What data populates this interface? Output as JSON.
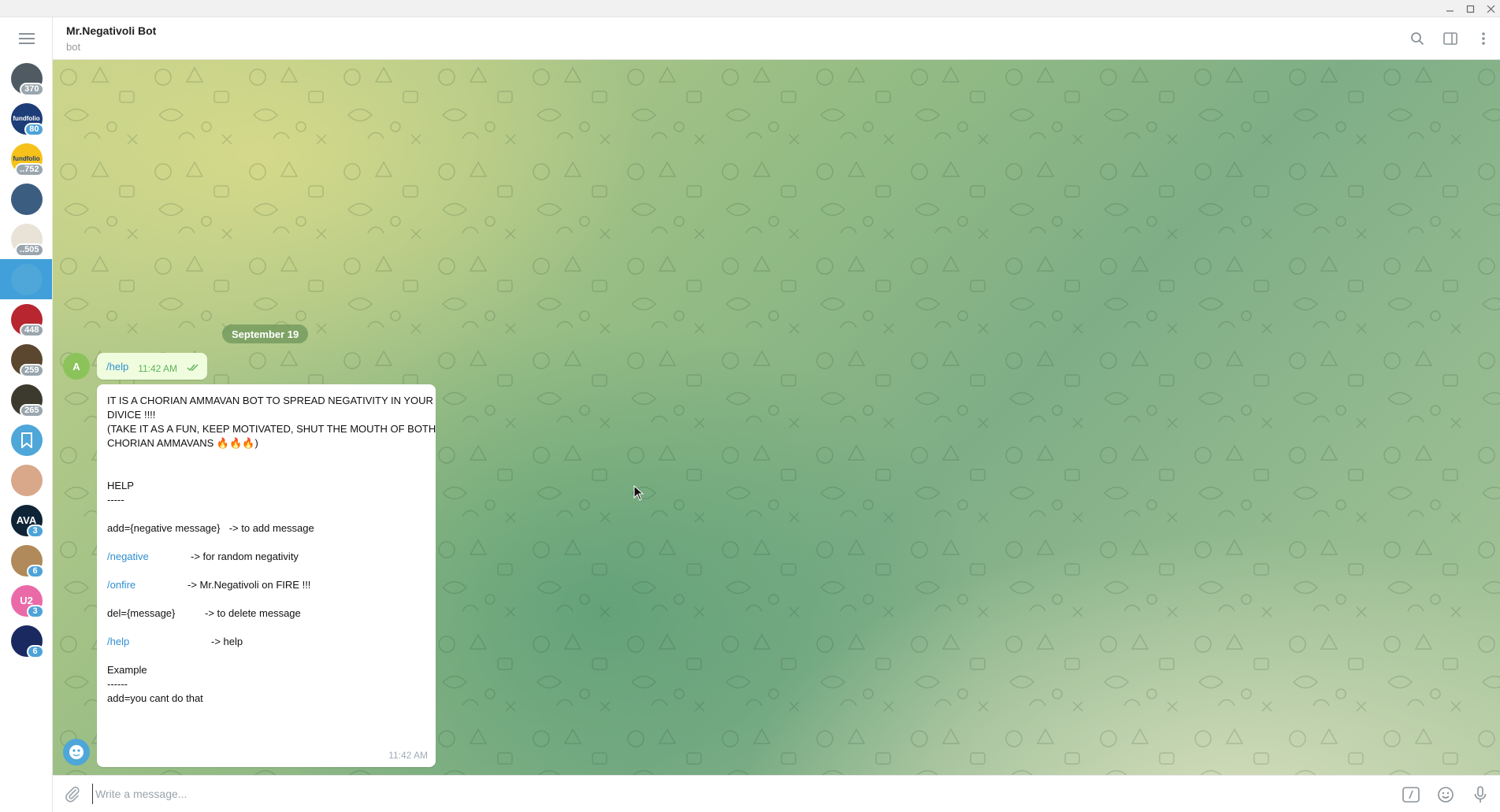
{
  "window": {
    "controls": [
      "minimize-icon",
      "maximize-icon",
      "close-icon"
    ]
  },
  "rail": {
    "items": [
      {
        "name": "chat-1",
        "badge": "370",
        "color": "#4f5a62",
        "label": ""
      },
      {
        "name": "chat-fundfolio-1",
        "badge": "80",
        "color": "#1d3d78",
        "label": "fundfolio"
      },
      {
        "name": "chat-fundfolio-2",
        "badge": "..752",
        "color": "#f6c21a",
        "label": "fundfolio"
      },
      {
        "name": "chat-person-1",
        "badge": "",
        "color": "#3b5d80",
        "label": ""
      },
      {
        "name": "chat-group-1",
        "badge": "..505",
        "color": "#e9e2d6",
        "label": ""
      },
      {
        "name": "chat-mr-negativoli-bot",
        "badge": "",
        "color": "#4ea6d9",
        "label": "",
        "active": true
      },
      {
        "name": "chat-group-2",
        "badge": "448",
        "color": "#b8262f",
        "label": ""
      },
      {
        "name": "chat-group-3",
        "badge": "259",
        "color": "#5b4630",
        "label": ""
      },
      {
        "name": "chat-group-4",
        "badge": "265",
        "color": "#3c3a2f",
        "label": ""
      },
      {
        "name": "saved-messages",
        "badge": "",
        "color": "#4ea6d9",
        "label": ""
      },
      {
        "name": "chat-person-2",
        "badge": "",
        "color": "#d9a88a",
        "label": ""
      },
      {
        "name": "chat-ava",
        "badge": "3",
        "color": "#0f2437",
        "label": "AVA"
      },
      {
        "name": "chat-group-5",
        "badge": "6",
        "color": "#b08a5a",
        "label": ""
      },
      {
        "name": "chat-u2",
        "badge": "3",
        "color": "#ea6aa8",
        "label": "U2"
      },
      {
        "name": "chat-group-6",
        "badge": "6",
        "color": "#1a2a60",
        "label": ""
      }
    ]
  },
  "header": {
    "title": "Mr.Negativoli Bot",
    "subtitle": "bot"
  },
  "messages": {
    "date": "September 19",
    "outgoing": {
      "avatar_letter": "A",
      "text": "/help",
      "time": "11:42 AM"
    },
    "incoming": {
      "time": "11:42 AM",
      "intro_1": "IT IS A CHORIAN AMMAVAN BOT TO SPREAD NEGATIVITY IN YOUR",
      "intro_2": "DIVICE !!!!",
      "intro_3": "(TAKE IT AS A FUN, KEEP MOTIVATED, SHUT THE MOUTH OF BOTH",
      "intro_4": "CHORIAN AMMAVANS 🔥🔥🔥)",
      "help_title": "HELP",
      "help_rule": "-----",
      "add_cmd": "add={negative message}",
      "add_desc": "  -> to add message",
      "negative_cmd": "/negative",
      "negative_desc": "-> for random negativity",
      "onfire_cmd": "/onfire",
      "onfire_desc": "-> Mr.Negativoli on FIRE !!!",
      "del_cmd": "del={message}",
      "del_desc": "-> to delete message",
      "help_cmd": "/help",
      "help_desc": "-> help",
      "example_title": "Example",
      "example_rule": "------",
      "example_line": "add=you cant do that"
    }
  },
  "composer": {
    "placeholder": "Write a message..."
  },
  "colors": {
    "accent": "#419fd9",
    "link": "#2f8fcf",
    "outgoing_bubble": "#effdde"
  }
}
